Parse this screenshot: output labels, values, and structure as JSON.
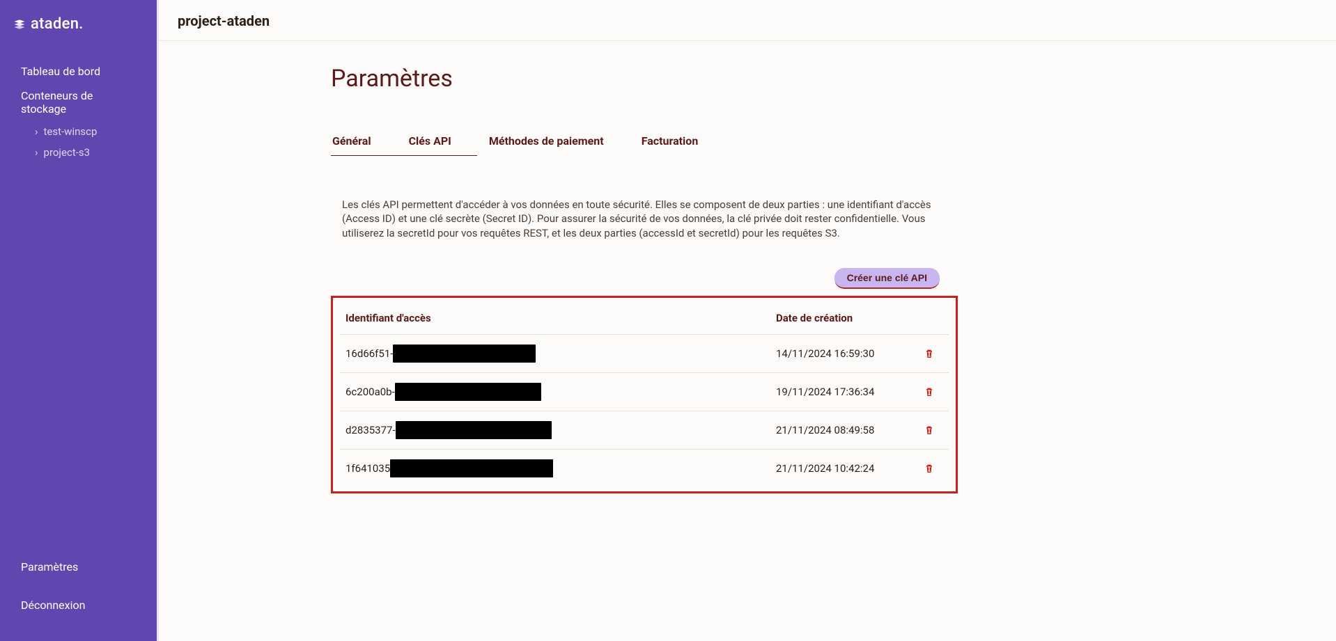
{
  "brand": {
    "name": "ataden."
  },
  "sidebar": {
    "nav": [
      {
        "label": "Tableau de bord"
      },
      {
        "label": "Conteneurs de stockage"
      }
    ],
    "subs": [
      {
        "label": "test-winscp"
      },
      {
        "label": "project-s3"
      }
    ],
    "bottom": [
      {
        "label": "Paramètres"
      },
      {
        "label": "Déconnexion"
      }
    ]
  },
  "header": {
    "project": "project-ataden"
  },
  "page": {
    "title": "Paramètres"
  },
  "tabs": [
    {
      "label": "Général",
      "active": true
    },
    {
      "label": "Clés API",
      "active": true
    },
    {
      "label": "Méthodes de paiement",
      "active": false
    },
    {
      "label": "Facturation",
      "active": false
    }
  ],
  "description": "Les clés API permettent d'accéder à vos données en toute sécurité. Elles se composent de deux parties : une identifiant d'accès (Access ID) et une clé secrète (Secret ID). Pour assurer la sécurité de vos données, la clé privée doit rester confidentielle. Vous utiliserez la secretId pour vos requêtes REST, et les deux parties (accessId et secretId) pour les requêtes S3.",
  "actions": {
    "create": "Créer une clé API"
  },
  "table": {
    "headers": {
      "access": "Identifiant d'accès",
      "created": "Date de création"
    },
    "rows": [
      {
        "prefix": "16d66f51-",
        "redact_w": 205,
        "created": "14/11/2024 16:59:30"
      },
      {
        "prefix": "6c200a0b-",
        "redact_w": 210,
        "created": "19/11/2024 17:36:34"
      },
      {
        "prefix": "d2835377-",
        "redact_w": 224,
        "created": "21/11/2024 08:49:58"
      },
      {
        "prefix": "1f641035",
        "redact_w": 234,
        "created": "21/11/2024 10:42:24"
      }
    ]
  }
}
